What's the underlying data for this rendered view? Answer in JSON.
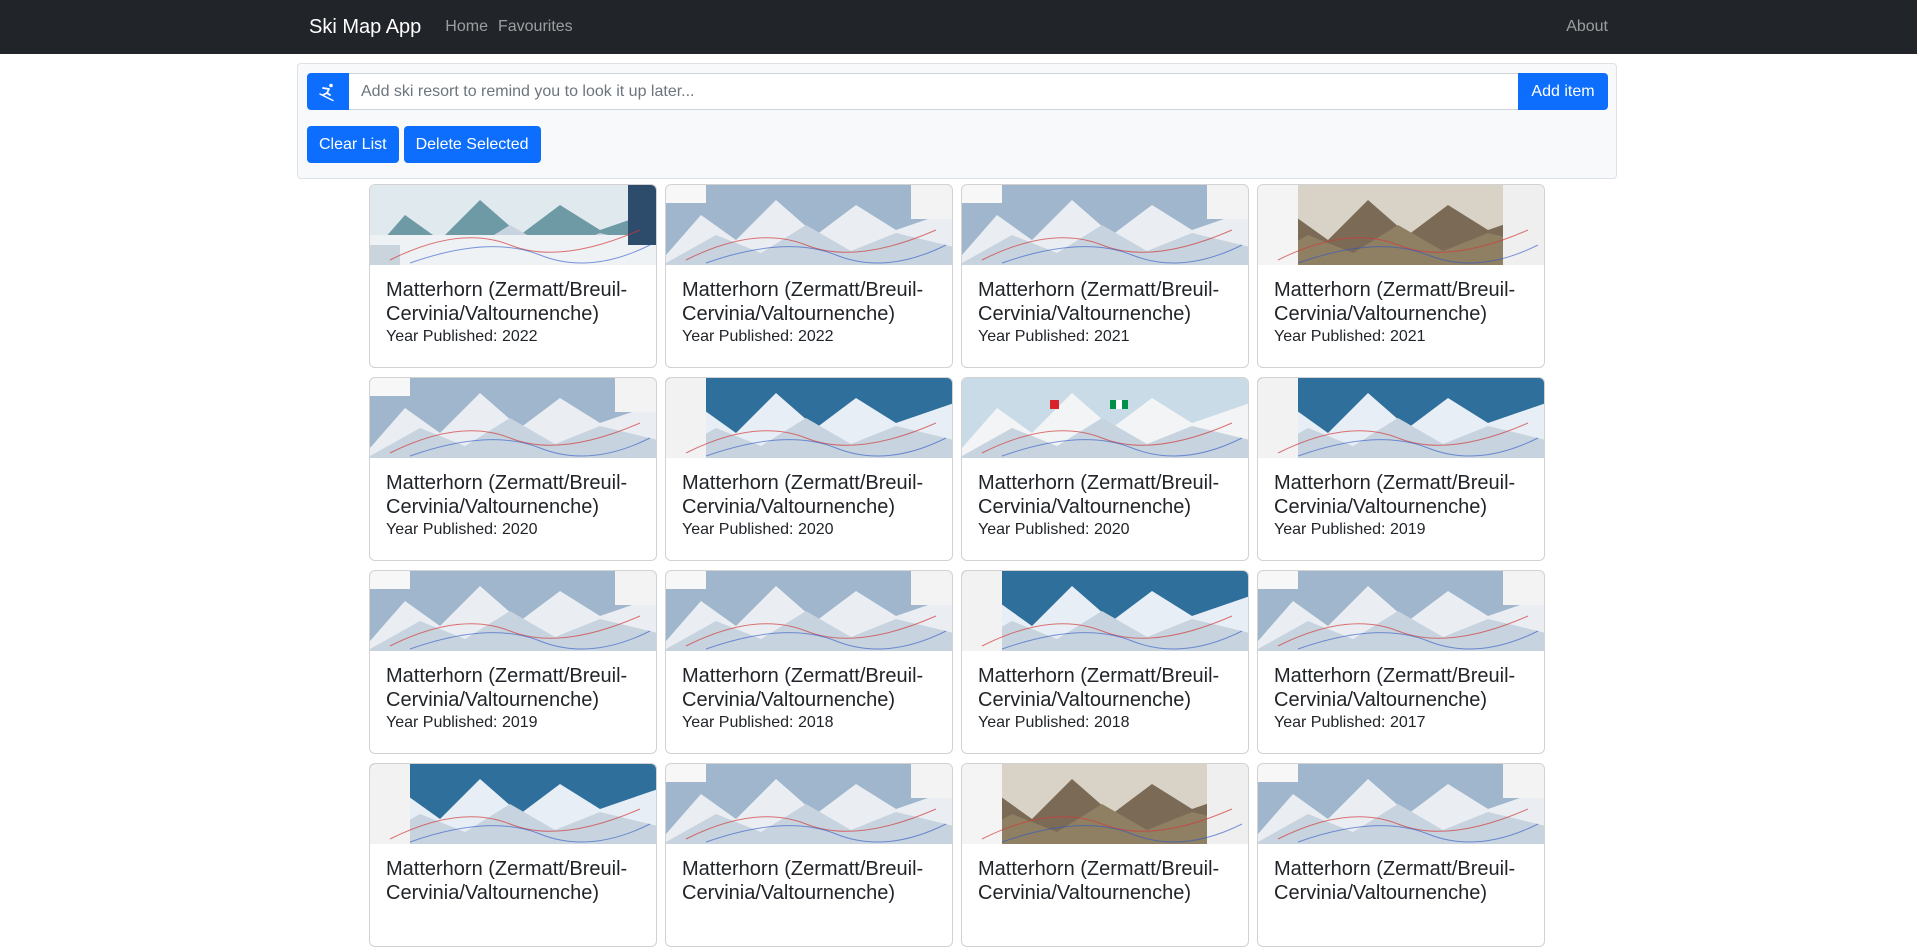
{
  "navbar": {
    "brand": "Ski Map App",
    "links": [
      "Home",
      "Favourites"
    ],
    "about": "About"
  },
  "add_form": {
    "icon": "skier-icon",
    "placeholder": "Add ski resort to remind you to look it up later...",
    "value": "",
    "add_label": "Add item"
  },
  "actions": {
    "clear_label": "Clear List",
    "delete_label": "Delete Selected"
  },
  "cards": [
    {
      "title": "Matterhorn (Zermatt/Breuil-Cervinia/Valtournenche)",
      "year": "Year Published: 2022",
      "style": "a"
    },
    {
      "title": "Matterhorn (Zermatt/Breuil-Cervinia/Valtournenche)",
      "year": "Year Published: 2022",
      "style": "b"
    },
    {
      "title": "Matterhorn (Zermatt/Breuil-Cervinia/Valtournenche)",
      "year": "Year Published: 2021",
      "style": "b"
    },
    {
      "title": "Matterhorn (Zermatt/Breuil-Cervinia/Valtournenche)",
      "year": "Year Published: 2021",
      "style": "c"
    },
    {
      "title": "Matterhorn (Zermatt/Breuil-Cervinia/Valtournenche)",
      "year": "Year Published: 2020",
      "style": "b"
    },
    {
      "title": "Matterhorn (Zermatt/Breuil-Cervinia/Valtournenche)",
      "year": "Year Published: 2020",
      "style": "d"
    },
    {
      "title": "Matterhorn (Zermatt/Breuil-Cervinia/Valtournenche)",
      "year": "Year Published: 2020",
      "style": "e"
    },
    {
      "title": "Matterhorn (Zermatt/Breuil-Cervinia/Valtournenche)",
      "year": "Year Published: 2019",
      "style": "d"
    },
    {
      "title": "Matterhorn (Zermatt/Breuil-Cervinia/Valtournenche)",
      "year": "Year Published: 2019",
      "style": "b"
    },
    {
      "title": "Matterhorn (Zermatt/Breuil-Cervinia/Valtournenche)",
      "year": "Year Published: 2018",
      "style": "b"
    },
    {
      "title": "Matterhorn (Zermatt/Breuil-Cervinia/Valtournenche)",
      "year": "Year Published: 2018",
      "style": "d"
    },
    {
      "title": "Matterhorn (Zermatt/Breuil-Cervinia/Valtournenche)",
      "year": "Year Published: 2017",
      "style": "b"
    },
    {
      "title": "Matterhorn (Zermatt/Breuil-Cervinia/Valtournenche)",
      "year": "",
      "style": "d"
    },
    {
      "title": "Matterhorn (Zermatt/Breuil-Cervinia/Valtournenche)",
      "year": "",
      "style": "b"
    },
    {
      "title": "Matterhorn (Zermatt/Breuil-Cervinia/Valtournenche)",
      "year": "",
      "style": "c"
    },
    {
      "title": "Matterhorn (Zermatt/Breuil-Cervinia/Valtournenche)",
      "year": "",
      "style": "b"
    }
  ],
  "colors": {
    "navbar_bg": "#212529",
    "primary": "#0d6efd",
    "panel_bg": "#f8f9fa"
  }
}
